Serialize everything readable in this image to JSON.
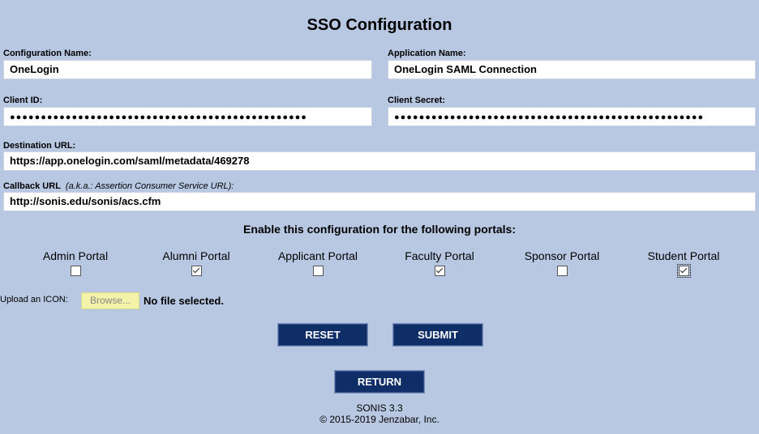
{
  "page": {
    "title": "SSO Configuration"
  },
  "fields": {
    "config_name": {
      "label": "Configuration Name:",
      "value": "OneLogin"
    },
    "app_name": {
      "label": "Application Name:",
      "value": "OneLogin SAML Connection"
    },
    "client_id": {
      "label": "Client ID:",
      "value": "●●●●●●●●●●●●●●●●●●●●●●●●●●●●●●●●●●●●●●●●●●●●●●●●"
    },
    "client_secret": {
      "label": "Client Secret:",
      "value": "●●●●●●●●●●●●●●●●●●●●●●●●●●●●●●●●●●●●●●●●●●●●●●●●●●"
    },
    "destination_url": {
      "label": "Destination URL:",
      "value": "https://app.onelogin.com/saml/metadata/469278"
    },
    "callback_url": {
      "label": "Callback URL",
      "aka": "(a.k.a.: Assertion Consumer Service URL):",
      "value": "http://sonis.edu/sonis/acs.cfm"
    }
  },
  "portals": {
    "heading": "Enable this configuration for the following portals:",
    "items": [
      {
        "label": "Admin Portal",
        "checked": false
      },
      {
        "label": "Alumni Portal",
        "checked": true
      },
      {
        "label": "Applicant Portal",
        "checked": false
      },
      {
        "label": "Faculty Portal",
        "checked": true
      },
      {
        "label": "Sponsor Portal",
        "checked": false
      },
      {
        "label": "Student Portal",
        "checked": true
      }
    ]
  },
  "upload": {
    "label": "Upload an ICON:",
    "browse_label": "Browse...",
    "status": "No file selected."
  },
  "buttons": {
    "reset": "RESET",
    "submit": "SUBMIT",
    "return": "RETURN"
  },
  "footer": {
    "version": "SONIS 3.3",
    "copyright": "© 2015-2019 Jenzabar, Inc."
  },
  "colors": {
    "background": "#b8c8e2",
    "button": "#0f2d67",
    "browse": "#f2f2a8"
  }
}
